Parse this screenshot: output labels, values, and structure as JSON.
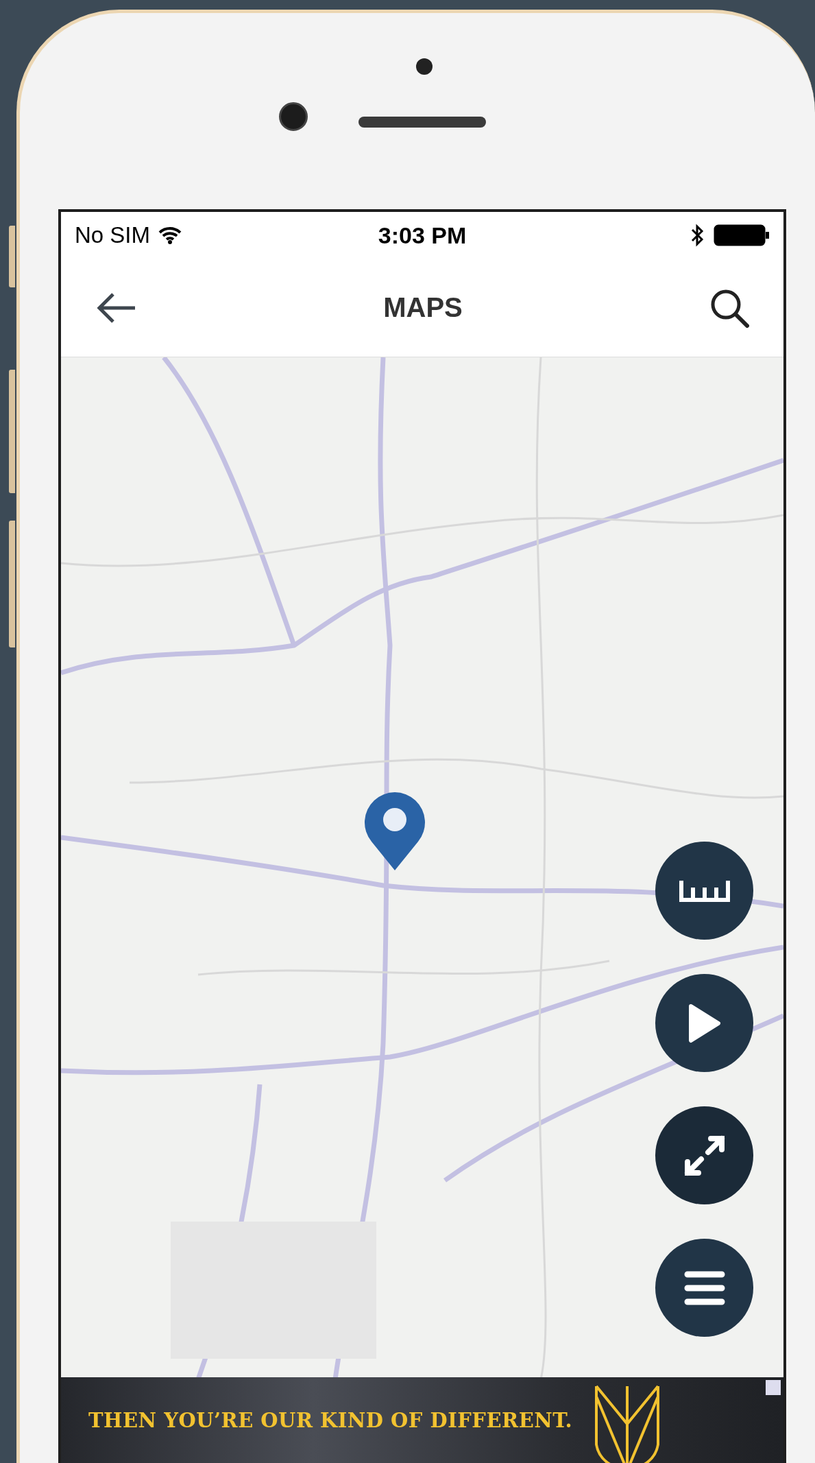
{
  "status_bar": {
    "carrier": "No SIM",
    "time": "3:03 PM"
  },
  "nav": {
    "title": "MAPS"
  },
  "map_controls": [
    {
      "kind": "ruler"
    },
    {
      "kind": "play"
    },
    {
      "kind": "expand"
    },
    {
      "kind": "menu"
    }
  ],
  "ad": {
    "text": "THEN YOU’RE OUR KIND OF DIFFERENT."
  }
}
